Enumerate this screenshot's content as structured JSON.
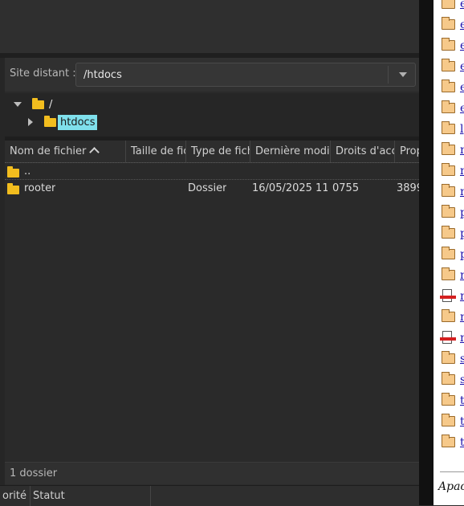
{
  "remote_site": {
    "label": "Site distant :",
    "path": "/htdocs"
  },
  "tree": {
    "root_label": "/",
    "child_label": "htdocs"
  },
  "file_list": {
    "columns": [
      "Nom de fichier",
      "Taille de fichier",
      "Type de fichier",
      "Dernière modification",
      "Droits d'accès",
      "Propriétaire/Groupe"
    ],
    "rows": [
      {
        "name": "..",
        "size": "",
        "type": "",
        "modified": "",
        "perms": "",
        "owner": ""
      },
      {
        "name": "rooter",
        "size": "",
        "type": "Dossier",
        "modified": "16/05/2025 11...",
        "perms": "0755",
        "owner": "3899"
      }
    ],
    "status": "1 dossier"
  },
  "queue_header": {
    "priority_label": "orité",
    "status_label": "Statut"
  },
  "browser": {
    "link_initials": [
      "e",
      "e",
      "e",
      "e",
      "e",
      "e",
      "l",
      "n",
      "n",
      "n",
      "p",
      "p",
      "p",
      "n",
      "n",
      "n",
      "n",
      "s",
      "s",
      "t",
      "t",
      "t"
    ],
    "row_icons": [
      "folder",
      "folder",
      "folder",
      "folder",
      "folder",
      "folder",
      "folder",
      "folder",
      "folder",
      "folder",
      "folder",
      "folder",
      "folder",
      "folder",
      "file",
      "folder",
      "file",
      "folder",
      "folder",
      "folder",
      "folder",
      "folder"
    ],
    "footer": "Apache"
  }
}
